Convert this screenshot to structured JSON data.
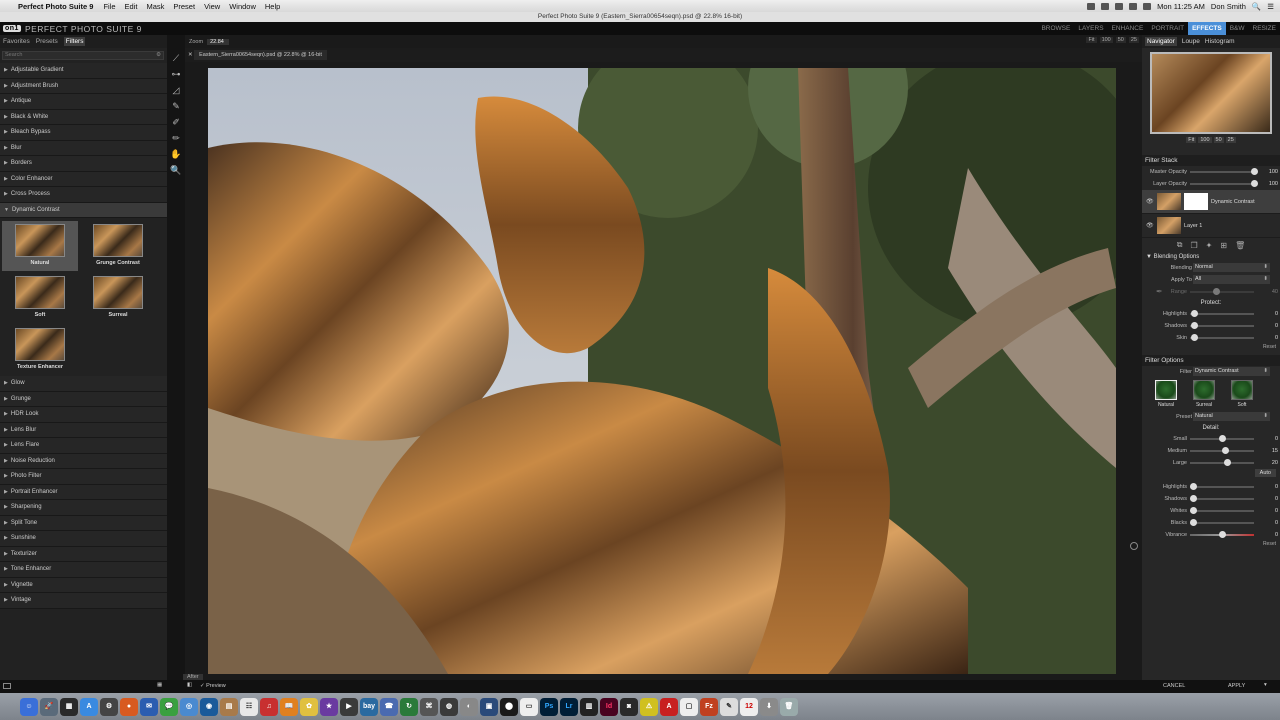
{
  "menubar": {
    "app_name": "Perfect Photo Suite 9",
    "items": [
      "File",
      "Edit",
      "Mask",
      "Preset",
      "View",
      "Window",
      "Help"
    ],
    "clock": "Mon 11:25 AM",
    "user": "Don Smith"
  },
  "window_title": "Perfect Photo Suite 9 (Eastern_Sierra00654seqn).psd @ 22.8% 16-bit)",
  "app_logo": "PERFECT PHOTO SUITE 9",
  "modules": [
    "BROWSE",
    "LAYERS",
    "ENHANCE",
    "PORTRAIT",
    "EFFECTS",
    "B&W",
    "RESIZE"
  ],
  "left_tabs": [
    "Favorites",
    "Presets",
    "Filters"
  ],
  "search_placeholder": "Search",
  "filters_before": [
    "Adjustable Gradient",
    "Adjustment Brush",
    "Antique",
    "Black & White",
    "Bleach Bypass",
    "Blur",
    "Borders",
    "Color Enhancer",
    "Cross Process"
  ],
  "open_filter": "Dynamic Contrast",
  "presets": [
    "Natural",
    "Grunge Contrast",
    "Soft",
    "Surreal",
    "Texture Enhancer"
  ],
  "filters_after": [
    "Glow",
    "Grunge",
    "HDR Look",
    "Lens Blur",
    "Lens Flare",
    "Noise Reduction",
    "Photo Filter",
    "Portrait Enhancer",
    "Sharpening",
    "Split Tone",
    "Sunshine",
    "Texturizer",
    "Tone Enhancer",
    "Vignette",
    "Vintage"
  ],
  "zoom": {
    "label": "Zoom",
    "value": "22.84"
  },
  "zoom_buttons": [
    "Fit",
    "100",
    "50",
    "25"
  ],
  "doc_tab": "Eastern_Sierra00654seqn).psd @ 22.8% @ 16-bit",
  "right_tabs": [
    "Navigator",
    "Loupe",
    "Histogram"
  ],
  "filter_stack": {
    "title": "Filter Stack",
    "master_opacity": {
      "label": "Master Opacity",
      "value": "100"
    },
    "layer_opacity": {
      "label": "Layer Opacity",
      "value": "100"
    },
    "layers": [
      "Dynamic Contrast",
      "Layer 1"
    ]
  },
  "blending": {
    "title": "Blending Options",
    "blending": {
      "label": "Blending",
      "value": "Normal"
    },
    "apply_to": {
      "label": "Apply To",
      "value": "All"
    },
    "range": {
      "label": "Range",
      "value": "40"
    },
    "protect_title": "Protect:",
    "protect": [
      {
        "label": "Highlights",
        "value": "0"
      },
      {
        "label": "Shadows",
        "value": "0"
      },
      {
        "label": "Skin",
        "value": "0"
      }
    ],
    "reset": "Reset"
  },
  "filter_options": {
    "title": "Filter Options",
    "filter": {
      "label": "Filter",
      "value": "Dynamic Contrast"
    },
    "looks": [
      "Natural",
      "Surreal",
      "Soft"
    ],
    "preset": {
      "label": "Preset",
      "value": "Natural"
    },
    "detail_title": "Detail:",
    "detail": [
      {
        "label": "Small",
        "value": "0",
        "pos": 0.5
      },
      {
        "label": "Medium",
        "value": "15",
        "pos": 0.55
      },
      {
        "label": "Large",
        "value": "20",
        "pos": 0.58
      }
    ],
    "auto": "Auto",
    "tones": [
      {
        "label": "Highlights",
        "value": "0",
        "pos": 0.0
      },
      {
        "label": "Shadows",
        "value": "0",
        "pos": 0.0
      },
      {
        "label": "Whites",
        "value": "0",
        "pos": 0.0
      },
      {
        "label": "Blacks",
        "value": "0",
        "pos": 0.0
      }
    ],
    "vibrance": {
      "label": "Vibrance",
      "value": "0",
      "pos": 0.5
    },
    "reset": "Reset"
  },
  "bottom": {
    "after": "After",
    "preview": "Preview",
    "cancel": "CANCEL",
    "apply": "APPLY"
  },
  "dock_apps": [
    "Ps",
    "Lr",
    "Id",
    "Fz",
    "12",
    "bay"
  ]
}
